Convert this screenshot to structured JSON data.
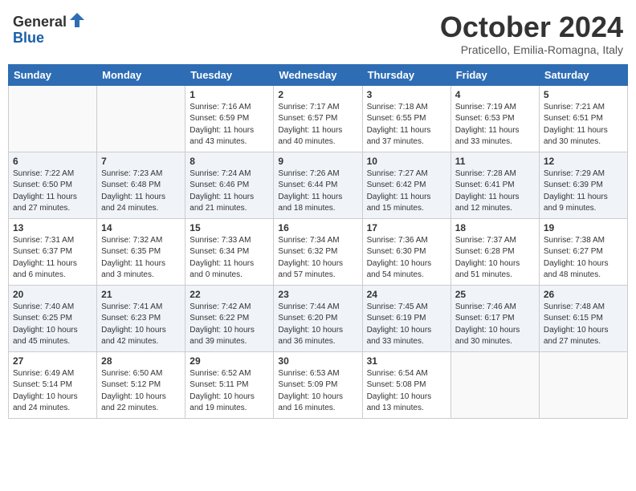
{
  "logo": {
    "general": "General",
    "blue": "Blue"
  },
  "title": "October 2024",
  "subtitle": "Praticello, Emilia-Romagna, Italy",
  "days_of_week": [
    "Sunday",
    "Monday",
    "Tuesday",
    "Wednesday",
    "Thursday",
    "Friday",
    "Saturday"
  ],
  "weeks": [
    [
      {
        "day": "",
        "info": ""
      },
      {
        "day": "",
        "info": ""
      },
      {
        "day": "1",
        "info": "Sunrise: 7:16 AM\nSunset: 6:59 PM\nDaylight: 11 hours and 43 minutes."
      },
      {
        "day": "2",
        "info": "Sunrise: 7:17 AM\nSunset: 6:57 PM\nDaylight: 11 hours and 40 minutes."
      },
      {
        "day": "3",
        "info": "Sunrise: 7:18 AM\nSunset: 6:55 PM\nDaylight: 11 hours and 37 minutes."
      },
      {
        "day": "4",
        "info": "Sunrise: 7:19 AM\nSunset: 6:53 PM\nDaylight: 11 hours and 33 minutes."
      },
      {
        "day": "5",
        "info": "Sunrise: 7:21 AM\nSunset: 6:51 PM\nDaylight: 11 hours and 30 minutes."
      }
    ],
    [
      {
        "day": "6",
        "info": "Sunrise: 7:22 AM\nSunset: 6:50 PM\nDaylight: 11 hours and 27 minutes."
      },
      {
        "day": "7",
        "info": "Sunrise: 7:23 AM\nSunset: 6:48 PM\nDaylight: 11 hours and 24 minutes."
      },
      {
        "day": "8",
        "info": "Sunrise: 7:24 AM\nSunset: 6:46 PM\nDaylight: 11 hours and 21 minutes."
      },
      {
        "day": "9",
        "info": "Sunrise: 7:26 AM\nSunset: 6:44 PM\nDaylight: 11 hours and 18 minutes."
      },
      {
        "day": "10",
        "info": "Sunrise: 7:27 AM\nSunset: 6:42 PM\nDaylight: 11 hours and 15 minutes."
      },
      {
        "day": "11",
        "info": "Sunrise: 7:28 AM\nSunset: 6:41 PM\nDaylight: 11 hours and 12 minutes."
      },
      {
        "day": "12",
        "info": "Sunrise: 7:29 AM\nSunset: 6:39 PM\nDaylight: 11 hours and 9 minutes."
      }
    ],
    [
      {
        "day": "13",
        "info": "Sunrise: 7:31 AM\nSunset: 6:37 PM\nDaylight: 11 hours and 6 minutes."
      },
      {
        "day": "14",
        "info": "Sunrise: 7:32 AM\nSunset: 6:35 PM\nDaylight: 11 hours and 3 minutes."
      },
      {
        "day": "15",
        "info": "Sunrise: 7:33 AM\nSunset: 6:34 PM\nDaylight: 11 hours and 0 minutes."
      },
      {
        "day": "16",
        "info": "Sunrise: 7:34 AM\nSunset: 6:32 PM\nDaylight: 10 hours and 57 minutes."
      },
      {
        "day": "17",
        "info": "Sunrise: 7:36 AM\nSunset: 6:30 PM\nDaylight: 10 hours and 54 minutes."
      },
      {
        "day": "18",
        "info": "Sunrise: 7:37 AM\nSunset: 6:28 PM\nDaylight: 10 hours and 51 minutes."
      },
      {
        "day": "19",
        "info": "Sunrise: 7:38 AM\nSunset: 6:27 PM\nDaylight: 10 hours and 48 minutes."
      }
    ],
    [
      {
        "day": "20",
        "info": "Sunrise: 7:40 AM\nSunset: 6:25 PM\nDaylight: 10 hours and 45 minutes."
      },
      {
        "day": "21",
        "info": "Sunrise: 7:41 AM\nSunset: 6:23 PM\nDaylight: 10 hours and 42 minutes."
      },
      {
        "day": "22",
        "info": "Sunrise: 7:42 AM\nSunset: 6:22 PM\nDaylight: 10 hours and 39 minutes."
      },
      {
        "day": "23",
        "info": "Sunrise: 7:44 AM\nSunset: 6:20 PM\nDaylight: 10 hours and 36 minutes."
      },
      {
        "day": "24",
        "info": "Sunrise: 7:45 AM\nSunset: 6:19 PM\nDaylight: 10 hours and 33 minutes."
      },
      {
        "day": "25",
        "info": "Sunrise: 7:46 AM\nSunset: 6:17 PM\nDaylight: 10 hours and 30 minutes."
      },
      {
        "day": "26",
        "info": "Sunrise: 7:48 AM\nSunset: 6:15 PM\nDaylight: 10 hours and 27 minutes."
      }
    ],
    [
      {
        "day": "27",
        "info": "Sunrise: 6:49 AM\nSunset: 5:14 PM\nDaylight: 10 hours and 24 minutes."
      },
      {
        "day": "28",
        "info": "Sunrise: 6:50 AM\nSunset: 5:12 PM\nDaylight: 10 hours and 22 minutes."
      },
      {
        "day": "29",
        "info": "Sunrise: 6:52 AM\nSunset: 5:11 PM\nDaylight: 10 hours and 19 minutes."
      },
      {
        "day": "30",
        "info": "Sunrise: 6:53 AM\nSunset: 5:09 PM\nDaylight: 10 hours and 16 minutes."
      },
      {
        "day": "31",
        "info": "Sunrise: 6:54 AM\nSunset: 5:08 PM\nDaylight: 10 hours and 13 minutes."
      },
      {
        "day": "",
        "info": ""
      },
      {
        "day": "",
        "info": ""
      }
    ]
  ]
}
